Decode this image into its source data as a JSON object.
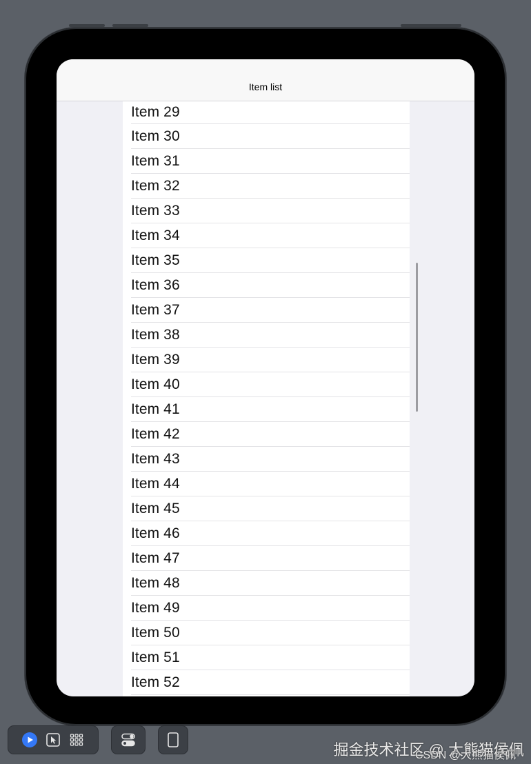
{
  "navbar": {
    "title": "Item list"
  },
  "items": [
    "Item 29",
    "Item 30",
    "Item 31",
    "Item 32",
    "Item 33",
    "Item 34",
    "Item 35",
    "Item 36",
    "Item 37",
    "Item 38",
    "Item 39",
    "Item 40",
    "Item 41",
    "Item 42",
    "Item 43",
    "Item 44",
    "Item 45",
    "Item 46",
    "Item 47",
    "Item 48",
    "Item 49",
    "Item 50",
    "Item 51",
    "Item 52"
  ],
  "toolbar": {
    "icons": [
      "play-icon",
      "pointer-icon",
      "grid-icon",
      "toggle-icon",
      "device-icon"
    ]
  },
  "watermark": {
    "line1": "掘金技术社区 @ 大熊猫侯佩",
    "line2": "CSDN @大熊猫侯佩"
  },
  "colors": {
    "accent": "#3478f6",
    "frame": "#000000",
    "background": "#5b6067"
  }
}
